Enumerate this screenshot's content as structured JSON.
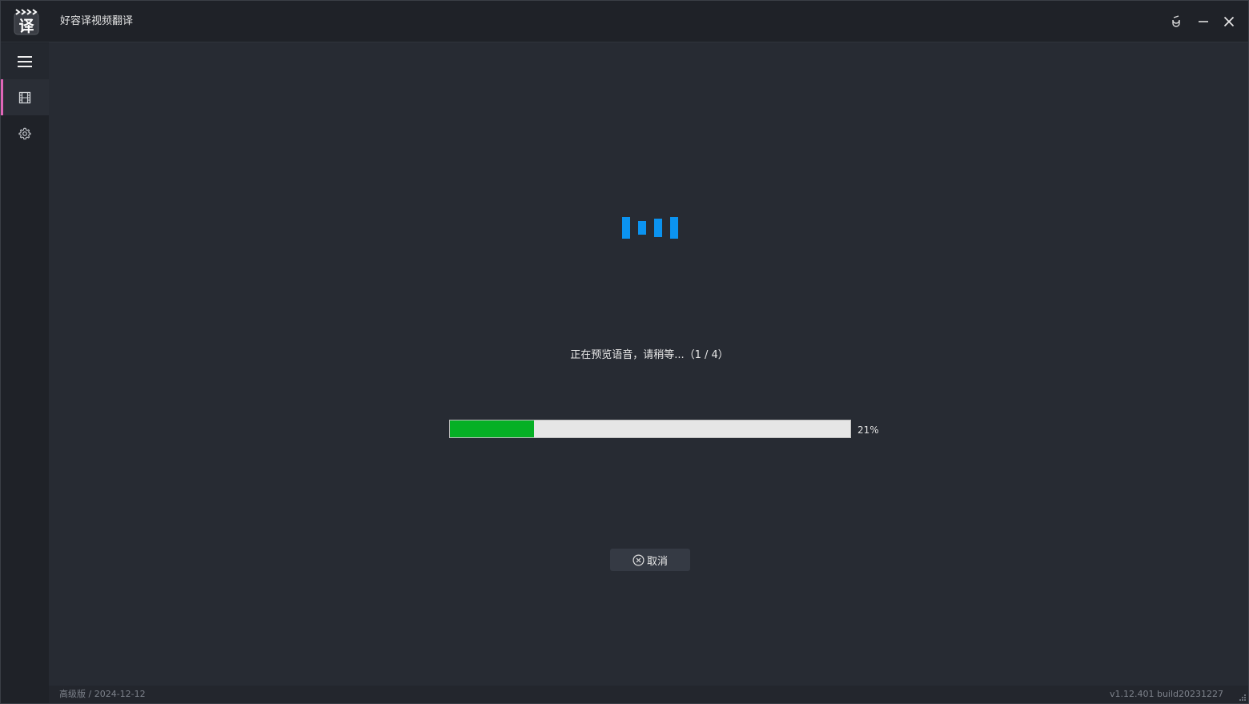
{
  "window": {
    "title": "好容译视频翻译",
    "logo_icon": "clapperboard-translate-logo"
  },
  "titlebar_buttons": {
    "pin_icon": "pin-icon",
    "minimize_icon": "minimize-icon",
    "close_icon": "close-icon"
  },
  "sidebar": {
    "items": [
      {
        "name": "menu",
        "icon": "hamburger-menu-icon"
      },
      {
        "name": "video",
        "icon": "film-icon",
        "active": true
      },
      {
        "name": "settings",
        "icon": "gear-icon"
      }
    ],
    "active_color": "#e066b8"
  },
  "main": {
    "status_text": "正在预览语音，请稍等...（1 / 4）",
    "progress": {
      "value": 0.21,
      "label": "21%",
      "fill_color": "#06b025"
    },
    "cancel_button": {
      "label": "取消",
      "icon": "circle-x-icon"
    },
    "loader_color": "#0b93f0"
  },
  "footer": {
    "left_text": "高级版 / 2024-12-12",
    "right_text": "v1.12.401 build20231227"
  }
}
